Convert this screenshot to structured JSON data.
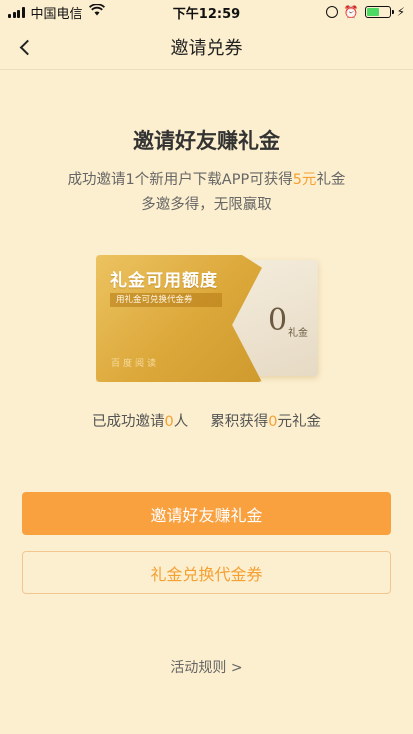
{
  "status_bar": {
    "carrier": "中国电信",
    "time": "下午12:59"
  },
  "nav": {
    "title": "邀请兑券"
  },
  "hero": {
    "title": "邀请好友赚礼金",
    "desc_prefix": "成功邀请1个新用户下载APP可获得",
    "desc_highlight": "5元",
    "desc_suffix": "礼金",
    "desc_line2": "多邀多得，无限赢取"
  },
  "card": {
    "title": "礼金可用额度",
    "subtitle": "用礼金可兑换代金券",
    "brand": "百度阅读",
    "amount": "0",
    "unit": "礼金"
  },
  "stats": {
    "invited_prefix": "已成功邀请",
    "invited_count": "0",
    "invited_suffix": "人",
    "earned_prefix": "累积获得",
    "earned_amount": "0",
    "earned_suffix": "元礼金"
  },
  "buttons": {
    "invite_label": "邀请好友赚礼金",
    "exchange_label": "礼金兑换代金券"
  },
  "rules_link": "活动规则 >",
  "colors": {
    "background": "#fcefcf",
    "accent": "#f9a03f",
    "highlight": "#f5a033",
    "card_gold": "#dca83a"
  }
}
